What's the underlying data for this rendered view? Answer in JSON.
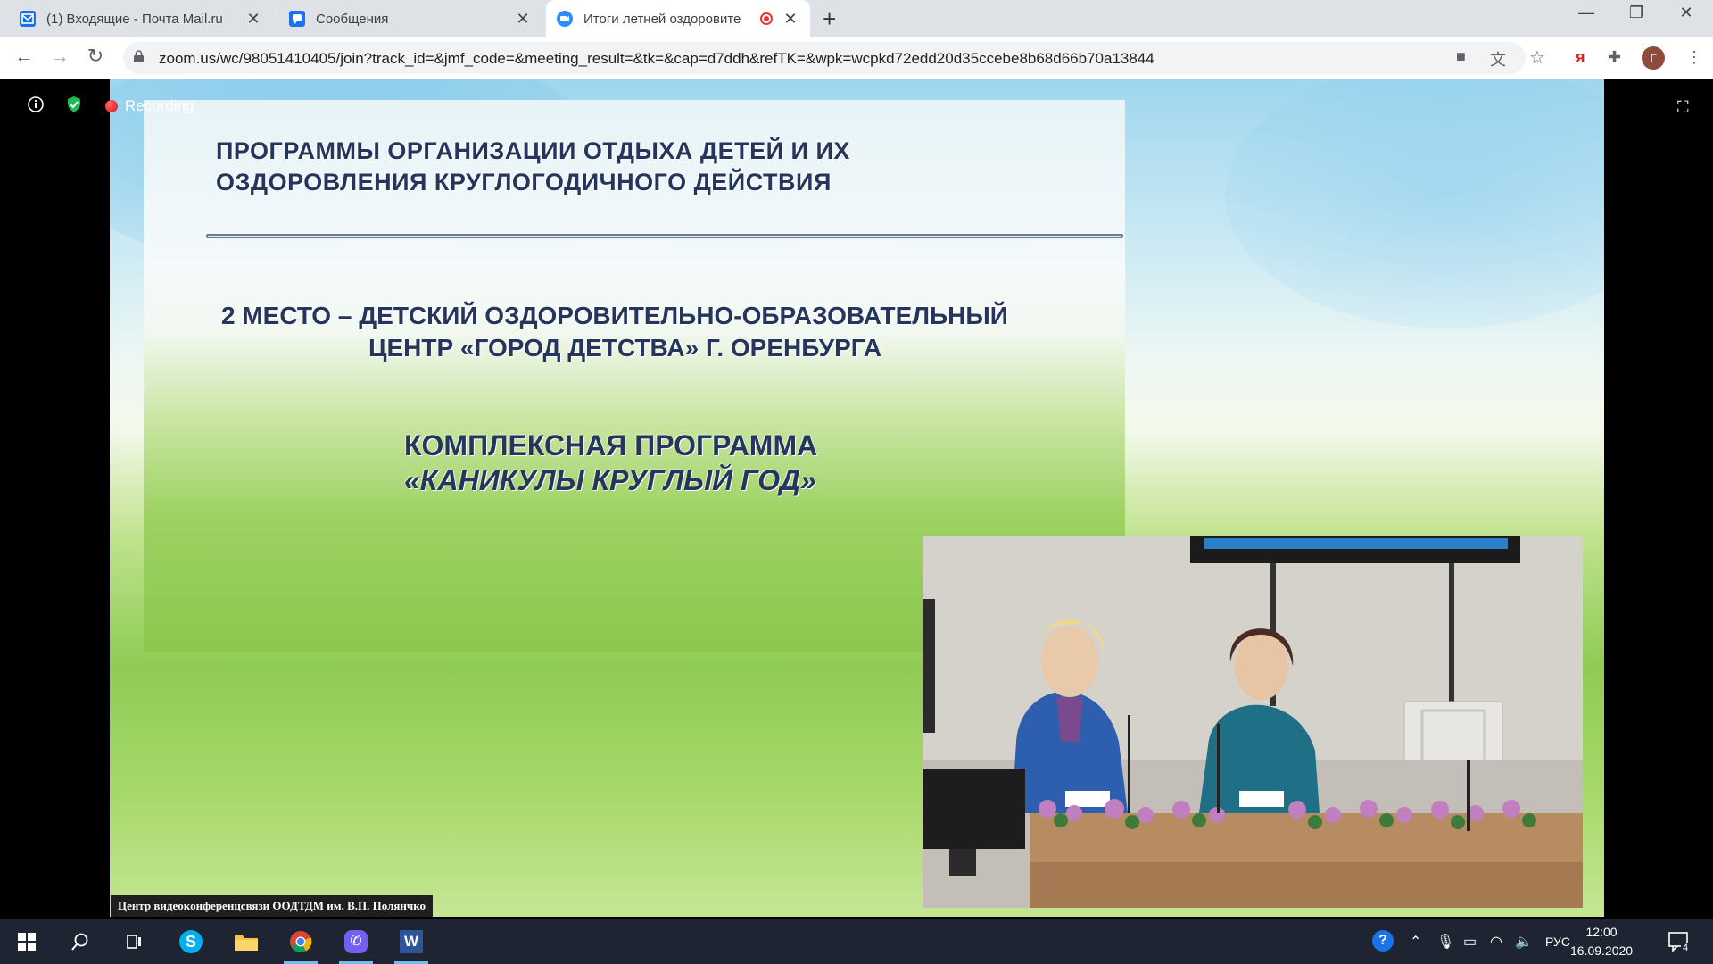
{
  "browser": {
    "tabs": [
      {
        "title": "(1) Входящие - Почта Mail.ru",
        "favicon": "mail-icon",
        "active": false
      },
      {
        "title": "Сообщения",
        "favicon": "chat-icon",
        "active": false
      },
      {
        "title": "Итоги летней оздоровите",
        "favicon": "zoom-icon",
        "active": true
      }
    ],
    "address": "zoom.us/wc/98051410405/join?track_id=&jmf_code=&meeting_result=&tk=&cap=d7ddh&refTK=&wpk=wcpkd72edd20d35ccebe8b68d66b70a13844",
    "profile_initial": "Г"
  },
  "meeting": {
    "recording_label": "Recording",
    "caption": "Центр видеоконференцсвязи ООДТДМ им. В.П. Полянчко"
  },
  "slide": {
    "header_line1": "ПРОГРАММЫ ОРГАНИЗАЦИИ ОТДЫХА ДЕТЕЙ И ИХ",
    "header_line2": "ОЗДОРОВЛЕНИЯ КРУГЛОГОДИЧНОГО ДЕЙСТВИЯ",
    "place_line1": "2 МЕСТО – ДЕТСКИЙ ОЗДОРОВИТЕЛЬНО-ОБРАЗОВАТЕЛЬНЫЙ",
    "place_line2": "ЦЕНТР «ГОРОД ДЕТСТВА» Г. ОРЕНБУРГА",
    "program_line1": "КОМПЛЕКСНАЯ ПРОГРАММА",
    "program_line2": "«КАНИКУЛЫ КРУГЛЫЙ ГОД»"
  },
  "taskbar": {
    "apps": [
      "start-icon",
      "search-icon",
      "task-view-icon",
      "skype-icon",
      "file-explorer-icon",
      "chrome-icon",
      "viber-icon",
      "word-icon"
    ],
    "language": "РУС",
    "time": "12:00",
    "date": "16.09.2020",
    "notifications": "4"
  }
}
